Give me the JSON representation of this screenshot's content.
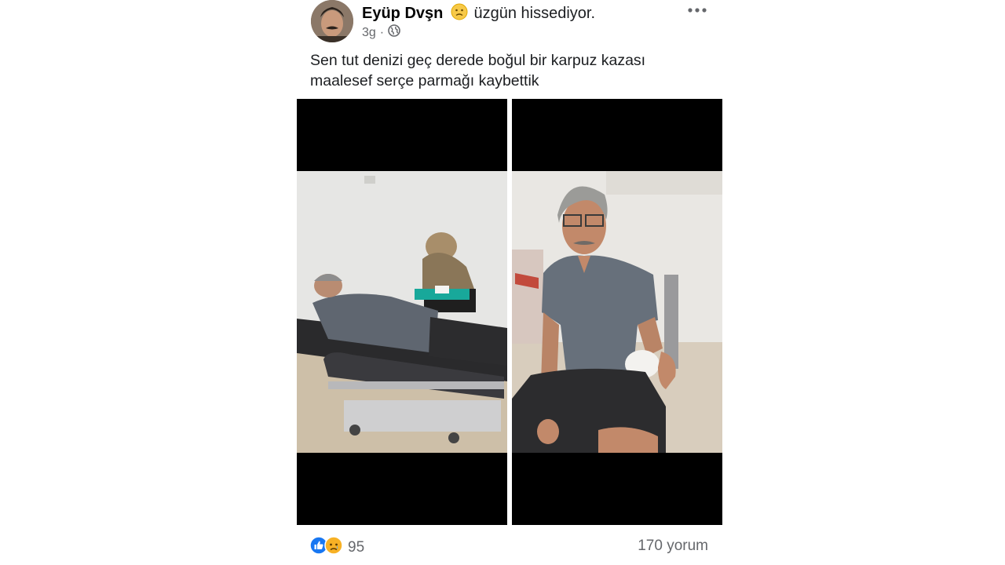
{
  "post": {
    "author": "Eyüp Dvşn",
    "feeling": "üzgün hissediyor.",
    "time": "3g",
    "privacy_icon": "globe-icon",
    "text_lines": [
      "Sen tut denizi geç derede boğul bir karpuz kazası",
      "maalesef serçe parmağı kaybettik"
    ],
    "photos": [
      {
        "icon": "photo-patient-on-hospital-bed"
      },
      {
        "icon": "photo-man-with-bandaged-hand"
      }
    ],
    "reactions": {
      "icons": [
        "like-icon",
        "sad-icon"
      ],
      "count": "95"
    },
    "comments": "170 yorum"
  },
  "colors": {
    "like_blue": "#1877f2",
    "emoji_yellow": "#f7b125",
    "secondary_text": "#65676b"
  }
}
